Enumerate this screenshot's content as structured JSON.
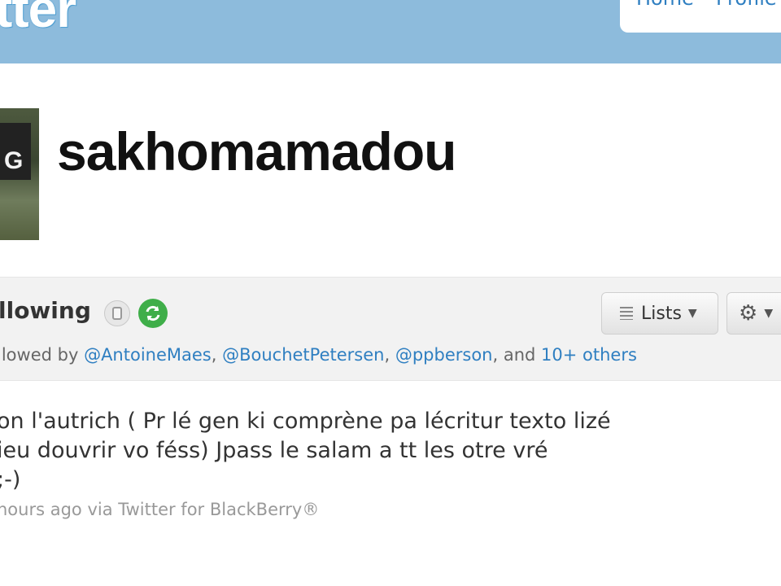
{
  "header": {
    "logo_text": "tter",
    "nav": [
      {
        "label": "Home"
      },
      {
        "label": "Profile"
      }
    ]
  },
  "profile": {
    "username": "sakhomamadou",
    "avatar_letter": "G"
  },
  "following_bar": {
    "label": "llowing",
    "followed_by_prefix": "llowed by ",
    "followers": [
      "@AntoineMaes",
      "@BouchetPetersen",
      "@ppberson"
    ],
    "and_text": ", and ",
    "others_link": "10+ others",
    "lists_label": "Lists",
    "icons": [
      "lock-icon",
      "follow-icon",
      "list-icon",
      "gear-icon",
      "chevron-down-icon"
    ]
  },
  "tweet": {
    "lines": [
      "on l'autrich ( Pr lé gen ki comprène pa lécritur texto lizé",
      "ieu douvrir vo féss) Jpass le salam a tt les otre vré",
      " ;-)"
    ],
    "meta": "hours ago via Twitter for BlackBerry®"
  },
  "colors": {
    "topbar": "#8dbbdc",
    "link": "#2f7fc1",
    "follow_green": "#3fae49"
  }
}
